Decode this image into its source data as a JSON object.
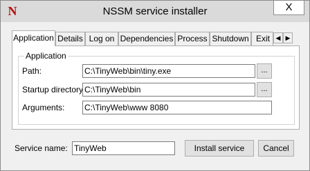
{
  "window": {
    "title": "NSSM service installer",
    "icon_letter": "N",
    "close_glyph": "X"
  },
  "tabs": [
    {
      "label": "Application",
      "active": true
    },
    {
      "label": "Details"
    },
    {
      "label": "Log on"
    },
    {
      "label": "Dependencies"
    },
    {
      "label": "Process"
    },
    {
      "label": "Shutdown"
    },
    {
      "label": "Exit"
    }
  ],
  "tab_scroll": {
    "left": "◀",
    "right": "▶"
  },
  "application_group": {
    "legend": "Application",
    "path_label": "Path:",
    "path_value": "C:\\TinyWeb\\bin\\tiny.exe",
    "startup_label": "Startup directory:",
    "startup_value": "C:\\TinyWeb\\bin",
    "arguments_label": "Arguments:",
    "arguments_value": "C:\\TinyWeb\\www 8080",
    "browse_label": "..."
  },
  "footer": {
    "service_name_label": "Service name:",
    "service_name_value": "TinyWeb",
    "install_label": "Install service",
    "cancel_label": "Cancel"
  }
}
